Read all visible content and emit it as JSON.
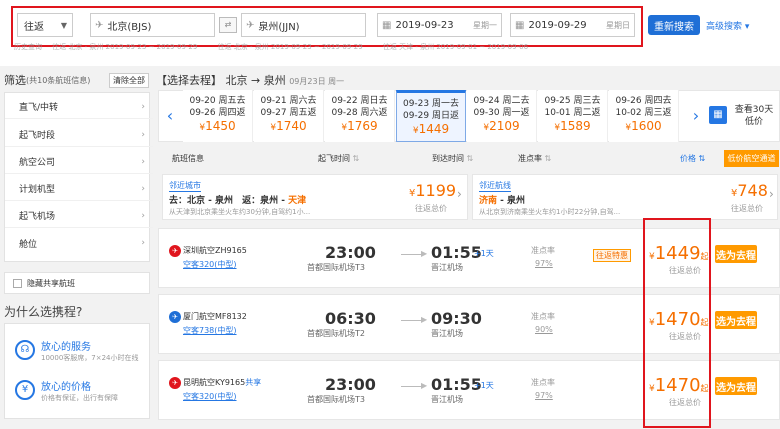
{
  "search": {
    "trip_type": "往返",
    "from": "北京(BJS)",
    "to": "泉州(JJN)",
    "depart_date": "2019-09-23",
    "depart_weekday": "星期一",
    "return_date": "2019-09-29",
    "return_weekday": "星期日",
    "search_btn": "重新搜索",
    "advanced": "高级搜索",
    "history": [
      "历史查询",
      "往返 北京 - 泉州 2019-09-23 ~ 2019-09-29",
      "往返 北京 - 泉州 2019-09-23 ~ 2019-09-29",
      "往返 天津 - 泉州 2019-09-01 ~ 2019-09-06"
    ]
  },
  "filter": {
    "title": "筛选",
    "count": "(共10条航班信息)",
    "clear": "清除全部",
    "items": [
      "直飞/中转",
      "起飞时段",
      "航空公司",
      "计划机型",
      "起飞机场",
      "舱位"
    ],
    "share_label": "隐藏共享航班"
  },
  "why": {
    "title": "为什么选携程?",
    "items": [
      {
        "title": "放心的服务",
        "desc": "10000客服席，7×24小时在线"
      },
      {
        "title": "放心的价格",
        "desc": "价格有保证，出行有保障"
      }
    ]
  },
  "route": {
    "label": "【选择去程】",
    "from": "北京",
    "arrow": "→",
    "to": "泉州",
    "date": "09月23日 周一"
  },
  "dates": [
    {
      "go": "09-20 周五去",
      "back": "09-26 周四返",
      "price": "1450"
    },
    {
      "go": "09-21 周六去",
      "back": "09-27 周五返",
      "price": "1740"
    },
    {
      "go": "09-22 周日去",
      "back": "09-28 周六返",
      "price": "1769"
    },
    {
      "go": "09-23 周一去",
      "back": "09-29 周日返",
      "price": "1449"
    },
    {
      "go": "09-24 周二去",
      "back": "09-30 周一返",
      "price": "2109"
    },
    {
      "go": "09-25 周三去",
      "back": "10-01 周二返",
      "price": "1589"
    },
    {
      "go": "09-26 周四去",
      "back": "10-02 周三返",
      "price": "1600"
    }
  ],
  "calendar_label": "查看30天低价",
  "currency": "¥",
  "columns": {
    "info": "航班信息",
    "dep": "起飞时间",
    "arr": "到达时间",
    "rate": "准点率",
    "price": "价格",
    "special": "低价航空通道"
  },
  "nearby": [
    {
      "tag": "邻近城市",
      "line1a": "去：北京 - 泉州",
      "line1b": "返：泉州 - ",
      "line1c": "天津",
      "desc": "从天津到北京乘坐火车约30分钟,自驾约1小...",
      "price": "1199",
      "note": "往返总价"
    },
    {
      "tag": "邻近航线",
      "line1a": "济南",
      "line1b": " - 泉州",
      "line1c": "",
      "desc": "从北京到济南乘坐火车约1小时22分钟,自驾...",
      "price": "748",
      "note": "往返总价"
    }
  ],
  "flights": [
    {
      "airline": "深圳航空ZH9165",
      "plane": "空客320(中型)",
      "share": "",
      "dep": "23:00",
      "dep_airport": "首都国际机场T3",
      "arr": "01:55",
      "plus": "+1天",
      "arr_airport": "晋江机场",
      "rate_label": "准点率",
      "rate": "97%",
      "badge": "往返特惠",
      "price": "1449",
      "qi": "起",
      "total": "往返总价",
      "book": "选为去程",
      "color": "#e0151d"
    },
    {
      "airline": "厦门航空MF8132",
      "plane": "空客738(中型)",
      "share": "",
      "dep": "06:30",
      "dep_airport": "首都国际机场T2",
      "arr": "09:30",
      "plus": "",
      "arr_airport": "晋江机场",
      "rate_label": "准点率",
      "rate": "90%",
      "badge": "",
      "price": "1470",
      "qi": "起",
      "total": "往返总价",
      "book": "选为去程",
      "color": "#1f6fd6"
    },
    {
      "airline": "昆明航空KY9165",
      "plane": "空客320(中型)",
      "share": "共享",
      "dep": "23:00",
      "dep_airport": "首都国际机场T3",
      "arr": "01:55",
      "plus": "+1天",
      "arr_airport": "晋江机场",
      "rate_label": "准点率",
      "rate": "97%",
      "badge": "",
      "price": "1470",
      "qi": "起",
      "total": "往返总价",
      "book": "选为去程",
      "color": "#e0151d"
    }
  ]
}
